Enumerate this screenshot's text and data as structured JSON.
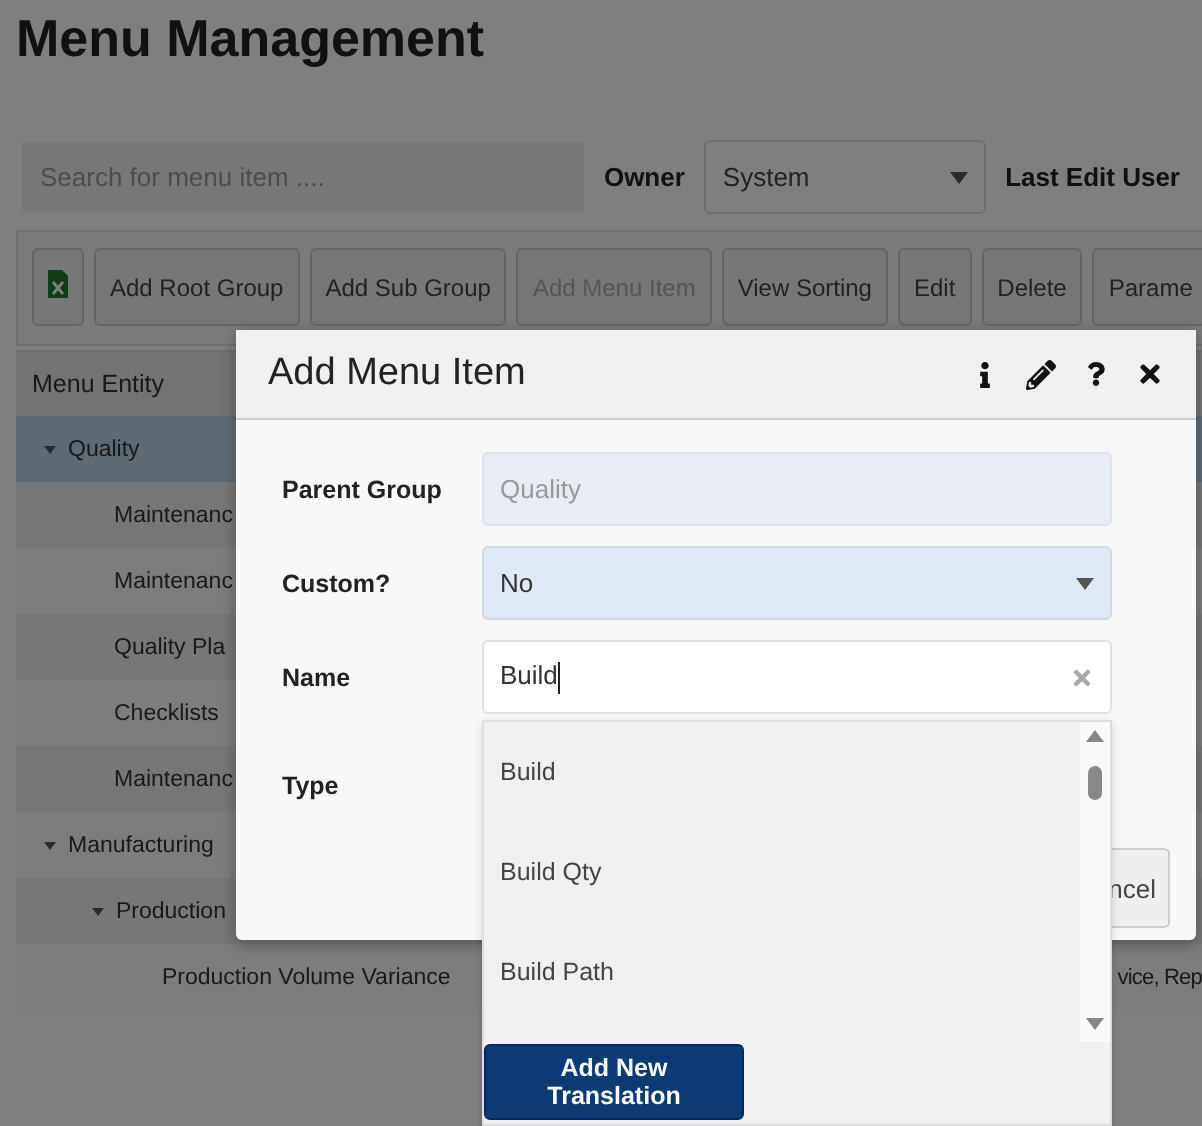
{
  "page": {
    "title": "Menu Management"
  },
  "filters": {
    "search_placeholder": "Search for menu item ....",
    "owner_label": "Owner",
    "owner_value": "System",
    "last_edit_label": "Last Edit User"
  },
  "toolbar": [
    {
      "kind": "excel",
      "disabled": false
    },
    {
      "kind": "text",
      "label": "Add Root Group",
      "disabled": false
    },
    {
      "kind": "text",
      "label": "Add Sub Group",
      "disabled": false
    },
    {
      "kind": "text",
      "label": "Add Menu Item",
      "disabled": true
    },
    {
      "kind": "text",
      "label": "View Sorting",
      "disabled": false
    },
    {
      "kind": "text",
      "label": "Edit",
      "disabled": false
    },
    {
      "kind": "text",
      "label": "Delete",
      "disabled": false
    },
    {
      "kind": "text",
      "label": "Parame",
      "disabled": false
    }
  ],
  "tree": {
    "header": "Menu Entity",
    "rows": [
      {
        "label": "Quality",
        "selected": true,
        "expanded": true,
        "children": [
          {
            "label": "Maintenanc",
            "selected": false
          },
          {
            "label": "Maintenanc",
            "selected": false
          },
          {
            "label": "Quality Pla",
            "selected": false
          },
          {
            "label": "Checklists",
            "selected": false
          },
          {
            "label": "Maintenanc",
            "selected": false
          }
        ]
      },
      {
        "label": "Manufacturing",
        "selected": false,
        "expanded": true,
        "children": [
          {
            "label": "Production",
            "selected": false,
            "expanded": true,
            "children": [
              {
                "label": "Production Volume Variance",
                "selected": false,
                "column_2": "vice, Rep"
              }
            ]
          }
        ]
      }
    ]
  },
  "modal": {
    "title": "Add Menu Item",
    "fields": [
      {
        "kind": "readonly",
        "label": "Parent Group",
        "value": "Quality"
      },
      {
        "kind": "select",
        "label": "Custom?",
        "value": "No"
      },
      {
        "kind": "input",
        "label": "Name",
        "value": "Build"
      },
      {
        "kind": "covered",
        "label": "Type"
      }
    ],
    "footer_buttons": [
      "ncel"
    ],
    "suggestions": {
      "items": [
        {
          "label": "Build"
        },
        {
          "label": "Build Qty"
        },
        {
          "label": "Build Path"
        }
      ],
      "action": "Add New Translation"
    }
  }
}
